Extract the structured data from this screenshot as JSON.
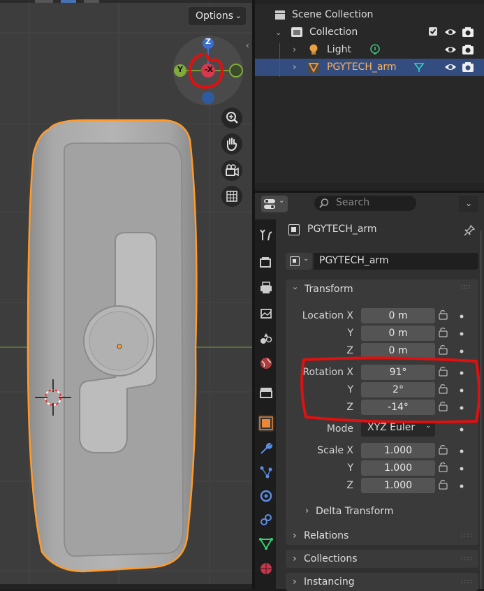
{
  "viewport": {
    "options_label": "Options",
    "gizmo": {
      "z": "Z",
      "y": "Y",
      "neg_x": "-X"
    }
  },
  "outliner": {
    "scene_collection": "Scene Collection",
    "collection": "Collection",
    "light": "Light",
    "object": "PGYTECH_arm"
  },
  "properties": {
    "search_placeholder": "Search",
    "object_name": "PGYTECH_arm",
    "name_field": "PGYTECH_arm",
    "transform": {
      "title": "Transform",
      "location_label": "Location X",
      "location": [
        "0 m",
        "0 m",
        "0 m"
      ],
      "rotation_label": "Rotation X",
      "rotation": [
        "91°",
        "2°",
        "-14°"
      ],
      "mode_label": "Mode",
      "mode_value": "XYZ Euler",
      "scale_label": "Scale X",
      "scale": [
        "1.000",
        "1.000",
        "1.000"
      ],
      "axis_y": "Y",
      "axis_z": "Z",
      "delta": "Delta Transform"
    },
    "panels": [
      "Relations",
      "Collections",
      "Instancing"
    ]
  },
  "colors": {
    "selection_outline": "#ff9a2b",
    "annotation_red": "#e01010",
    "selected_row": "#334d80",
    "object_orange": "#e8883a"
  }
}
